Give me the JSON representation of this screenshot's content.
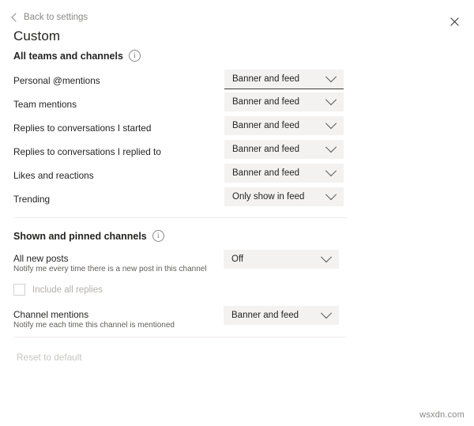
{
  "window": {
    "back_label": "Back to settings",
    "title": "Custom",
    "close_icon": "close-icon",
    "back_icon": "chevron-left-icon"
  },
  "sections": [
    {
      "id": "all-teams-and-channels",
      "heading": "All teams and channels",
      "info_icon": "info-icon",
      "rows": [
        {
          "label": "Personal @mentions",
          "value": "Banner and feed",
          "focused": true
        },
        {
          "label": "Team mentions",
          "value": "Banner and feed",
          "focused": false
        },
        {
          "label": "Replies to conversations I started",
          "value": "Banner and feed",
          "focused": false
        },
        {
          "label": "Replies to conversations I replied to",
          "value": "Banner and feed",
          "focused": false
        },
        {
          "label": "Likes and reactions",
          "value": "Banner and feed",
          "focused": false
        },
        {
          "label": "Trending",
          "value": "Only show in feed",
          "focused": false
        }
      ]
    },
    {
      "id": "shown-and-pinned-channels",
      "heading": "Shown and pinned channels",
      "info_icon": "info-icon",
      "rows": [
        {
          "label": "All new posts",
          "sub": "Notify me every time there is a new post in this channel",
          "value": "Off"
        },
        {
          "label": "Channel mentions",
          "sub": "Notify me each time this channel is mentioned",
          "value": "Banner and feed"
        }
      ],
      "checkbox": {
        "label": "Include all replies",
        "checked": false,
        "disabled": true
      }
    }
  ],
  "footer": {
    "reset_label": "Reset to default",
    "reset_disabled": true
  },
  "watermark": "wsxdn.com",
  "dropdown_options": [
    "Banner and feed",
    "Only show in feed",
    "Off"
  ],
  "colors": {
    "background": "#ffffff",
    "dropdown_fill": "#f3f2f1",
    "text_primary": "#252423",
    "text_secondary": "#605e5c",
    "text_disabled": "#c8c6c4",
    "divider": "#edebe9",
    "focus_underline": "#3b3a39"
  }
}
